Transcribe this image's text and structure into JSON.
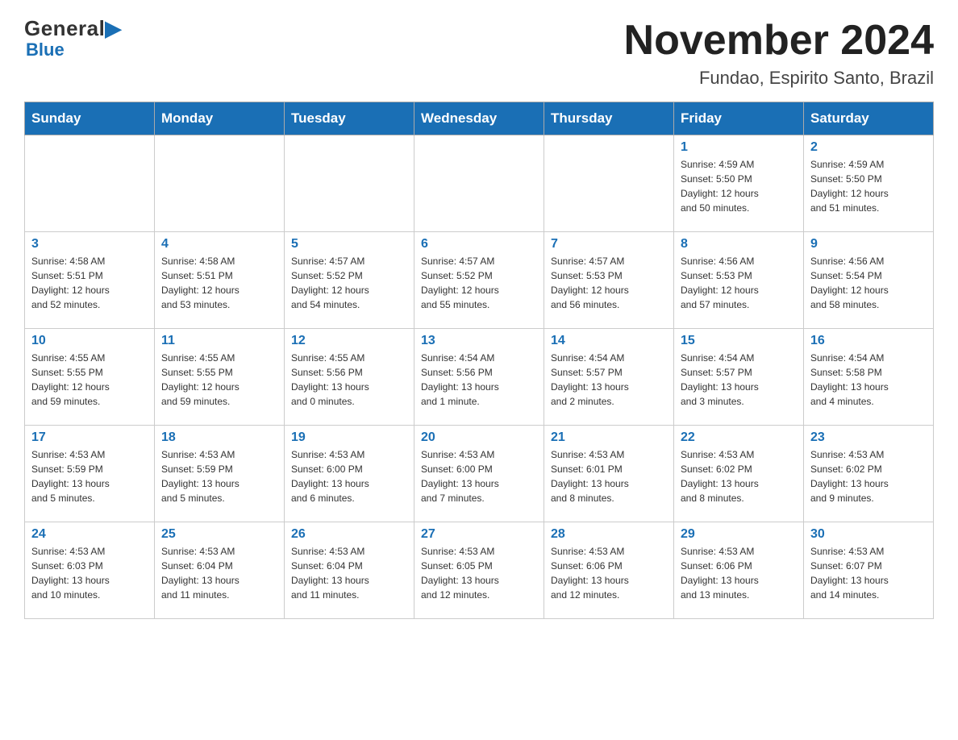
{
  "logo": {
    "general": "General",
    "blue": "Blue",
    "triangle": "▶"
  },
  "title": "November 2024",
  "subtitle": "Fundao, Espirito Santo, Brazil",
  "weekdays": [
    "Sunday",
    "Monday",
    "Tuesday",
    "Wednesday",
    "Thursday",
    "Friday",
    "Saturday"
  ],
  "weeks": [
    [
      {
        "day": "",
        "info": ""
      },
      {
        "day": "",
        "info": ""
      },
      {
        "day": "",
        "info": ""
      },
      {
        "day": "",
        "info": ""
      },
      {
        "day": "",
        "info": ""
      },
      {
        "day": "1",
        "info": "Sunrise: 4:59 AM\nSunset: 5:50 PM\nDaylight: 12 hours\nand 50 minutes."
      },
      {
        "day": "2",
        "info": "Sunrise: 4:59 AM\nSunset: 5:50 PM\nDaylight: 12 hours\nand 51 minutes."
      }
    ],
    [
      {
        "day": "3",
        "info": "Sunrise: 4:58 AM\nSunset: 5:51 PM\nDaylight: 12 hours\nand 52 minutes."
      },
      {
        "day": "4",
        "info": "Sunrise: 4:58 AM\nSunset: 5:51 PM\nDaylight: 12 hours\nand 53 minutes."
      },
      {
        "day": "5",
        "info": "Sunrise: 4:57 AM\nSunset: 5:52 PM\nDaylight: 12 hours\nand 54 minutes."
      },
      {
        "day": "6",
        "info": "Sunrise: 4:57 AM\nSunset: 5:52 PM\nDaylight: 12 hours\nand 55 minutes."
      },
      {
        "day": "7",
        "info": "Sunrise: 4:57 AM\nSunset: 5:53 PM\nDaylight: 12 hours\nand 56 minutes."
      },
      {
        "day": "8",
        "info": "Sunrise: 4:56 AM\nSunset: 5:53 PM\nDaylight: 12 hours\nand 57 minutes."
      },
      {
        "day": "9",
        "info": "Sunrise: 4:56 AM\nSunset: 5:54 PM\nDaylight: 12 hours\nand 58 minutes."
      }
    ],
    [
      {
        "day": "10",
        "info": "Sunrise: 4:55 AM\nSunset: 5:55 PM\nDaylight: 12 hours\nand 59 minutes."
      },
      {
        "day": "11",
        "info": "Sunrise: 4:55 AM\nSunset: 5:55 PM\nDaylight: 12 hours\nand 59 minutes."
      },
      {
        "day": "12",
        "info": "Sunrise: 4:55 AM\nSunset: 5:56 PM\nDaylight: 13 hours\nand 0 minutes."
      },
      {
        "day": "13",
        "info": "Sunrise: 4:54 AM\nSunset: 5:56 PM\nDaylight: 13 hours\nand 1 minute."
      },
      {
        "day": "14",
        "info": "Sunrise: 4:54 AM\nSunset: 5:57 PM\nDaylight: 13 hours\nand 2 minutes."
      },
      {
        "day": "15",
        "info": "Sunrise: 4:54 AM\nSunset: 5:57 PM\nDaylight: 13 hours\nand 3 minutes."
      },
      {
        "day": "16",
        "info": "Sunrise: 4:54 AM\nSunset: 5:58 PM\nDaylight: 13 hours\nand 4 minutes."
      }
    ],
    [
      {
        "day": "17",
        "info": "Sunrise: 4:53 AM\nSunset: 5:59 PM\nDaylight: 13 hours\nand 5 minutes."
      },
      {
        "day": "18",
        "info": "Sunrise: 4:53 AM\nSunset: 5:59 PM\nDaylight: 13 hours\nand 5 minutes."
      },
      {
        "day": "19",
        "info": "Sunrise: 4:53 AM\nSunset: 6:00 PM\nDaylight: 13 hours\nand 6 minutes."
      },
      {
        "day": "20",
        "info": "Sunrise: 4:53 AM\nSunset: 6:00 PM\nDaylight: 13 hours\nand 7 minutes."
      },
      {
        "day": "21",
        "info": "Sunrise: 4:53 AM\nSunset: 6:01 PM\nDaylight: 13 hours\nand 8 minutes."
      },
      {
        "day": "22",
        "info": "Sunrise: 4:53 AM\nSunset: 6:02 PM\nDaylight: 13 hours\nand 8 minutes."
      },
      {
        "day": "23",
        "info": "Sunrise: 4:53 AM\nSunset: 6:02 PM\nDaylight: 13 hours\nand 9 minutes."
      }
    ],
    [
      {
        "day": "24",
        "info": "Sunrise: 4:53 AM\nSunset: 6:03 PM\nDaylight: 13 hours\nand 10 minutes."
      },
      {
        "day": "25",
        "info": "Sunrise: 4:53 AM\nSunset: 6:04 PM\nDaylight: 13 hours\nand 11 minutes."
      },
      {
        "day": "26",
        "info": "Sunrise: 4:53 AM\nSunset: 6:04 PM\nDaylight: 13 hours\nand 11 minutes."
      },
      {
        "day": "27",
        "info": "Sunrise: 4:53 AM\nSunset: 6:05 PM\nDaylight: 13 hours\nand 12 minutes."
      },
      {
        "day": "28",
        "info": "Sunrise: 4:53 AM\nSunset: 6:06 PM\nDaylight: 13 hours\nand 12 minutes."
      },
      {
        "day": "29",
        "info": "Sunrise: 4:53 AM\nSunset: 6:06 PM\nDaylight: 13 hours\nand 13 minutes."
      },
      {
        "day": "30",
        "info": "Sunrise: 4:53 AM\nSunset: 6:07 PM\nDaylight: 13 hours\nand 14 minutes."
      }
    ]
  ]
}
